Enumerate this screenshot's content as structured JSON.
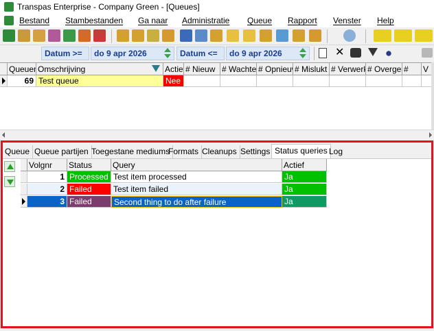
{
  "app": {
    "title": "Transpas Enterprise - Company Green - [Queues]"
  },
  "menu": {
    "items": [
      "Bestand",
      "Stambestanden",
      "Ga naar",
      "Administratie",
      "Queue",
      "Rapport",
      "Venster",
      "Help"
    ]
  },
  "filter": {
    "date_from_label": "Datum >=",
    "date_from_value": "do 9 apr 2026",
    "date_to_label": "Datum <=",
    "date_to_value": "do 9 apr 2026"
  },
  "queue_grid": {
    "columns": [
      "Queuenr",
      "Omschrijving",
      "Actief",
      "# Nieuw",
      "# Wachtend",
      "# Opnieuw",
      "# Mislukt",
      "# Verwerkt",
      "# Overgeslagen",
      "#",
      "V"
    ],
    "rows": [
      {
        "nr": "69",
        "omschrijving": "Test queue",
        "actief": "Nee"
      }
    ]
  },
  "tabs": [
    "Queue",
    "Queue partijen",
    "Toegestane mediums",
    "Formats",
    "Cleanups",
    "Settings",
    "Status queries",
    "Log"
  ],
  "active_tab": "Status queries",
  "status_grid": {
    "columns": [
      "Volgnr",
      "Status",
      "Query",
      "Actief"
    ],
    "rows": [
      {
        "volgnr": "1",
        "status": "Processed",
        "query": "Test item processed",
        "actief": "Ja"
      },
      {
        "volgnr": "2",
        "status": "Failed",
        "query": "Test item failed",
        "actief": "Ja"
      },
      {
        "volgnr": "3",
        "status": "Failed",
        "query": "Second thing to do after failure",
        "actief": "Ja"
      }
    ]
  },
  "colors": {
    "processed": "#00c000",
    "failed": "#ff0000",
    "selected_status": "#7a3d6e",
    "selected_row": "#0a64c8",
    "active_green": "#00c000",
    "selected_active": "#0f9a64",
    "highlight_frame": "#e0141e",
    "date_label": "#1a3c8c"
  }
}
